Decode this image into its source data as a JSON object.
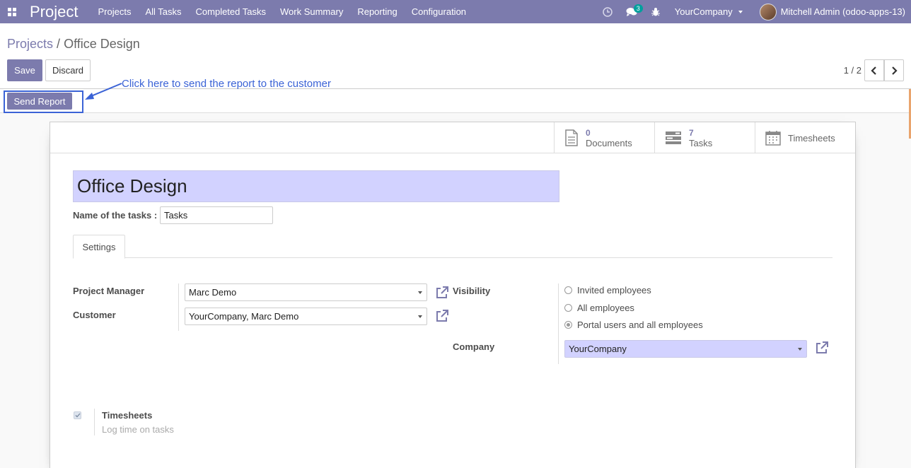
{
  "navbar": {
    "app_title": "Project",
    "menu": [
      "Projects",
      "All Tasks",
      "Completed Tasks",
      "Work Summary",
      "Reporting",
      "Configuration"
    ],
    "messages_badge": "3",
    "company": "YourCompany",
    "user": "Mitchell Admin (odoo-apps-13)"
  },
  "breadcrumb": {
    "parent": "Projects",
    "separator": "/",
    "current": "Office Design"
  },
  "buttons": {
    "save": "Save",
    "discard": "Discard",
    "send_report": "Send Report"
  },
  "pager": {
    "value": "1 / 2"
  },
  "annotation": "Click here to send the report to the customer",
  "smart_buttons": {
    "documents": {
      "value": "0",
      "label": "Documents"
    },
    "tasks": {
      "value": "7",
      "label": "Tasks"
    },
    "timesheets": {
      "label": "Timesheets"
    }
  },
  "form": {
    "title": "Office Design",
    "name_of_tasks_label": "Name of the tasks :",
    "name_of_tasks_value": "Tasks",
    "tab_settings": "Settings",
    "project_manager_label": "Project Manager",
    "project_manager_value": "Marc Demo",
    "customer_label": "Customer",
    "customer_value": "YourCompany, Marc Demo",
    "visibility_label": "Visibility",
    "visibility_options": [
      "Invited employees",
      "All employees",
      "Portal users and all employees"
    ],
    "visibility_selected": "Portal users and all employees",
    "company_label": "Company",
    "company_value": "YourCompany",
    "timesheets_title": "Timesheets",
    "timesheets_desc": "Log time on tasks",
    "timesheets_checked": true
  },
  "colors": {
    "brand": "#7c7bad",
    "annotation": "#3b63d6",
    "required_field": "#d2d2ff"
  }
}
